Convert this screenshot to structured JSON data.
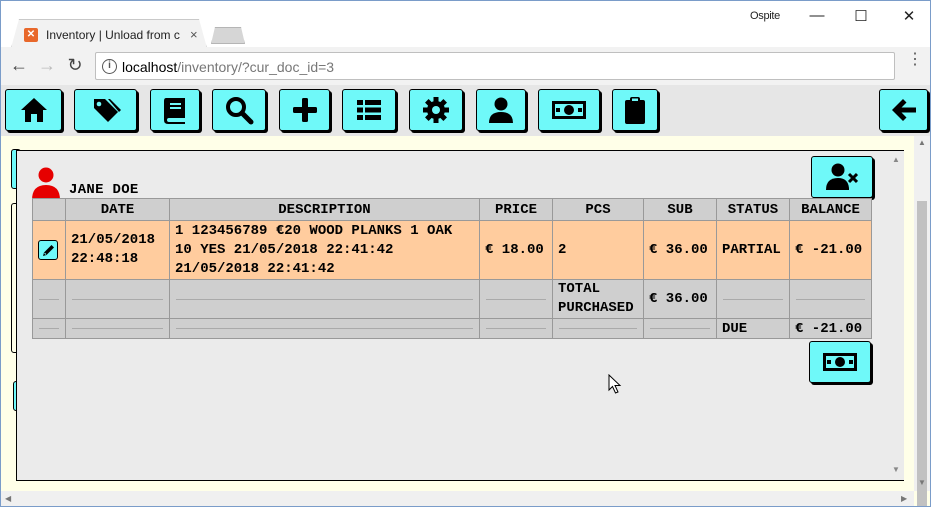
{
  "browser": {
    "tab_title": "Inventory | Unload from c",
    "profile_name": "Ospite",
    "url_host": "localhost",
    "url_path": "/inventory/?cur_doc_id=3"
  },
  "toolbar_icons": [
    "home-icon",
    "tags-icon",
    "book-icon",
    "search-icon",
    "plus-icon",
    "list-icon",
    "gear-icon",
    "user-icon",
    "money-icon",
    "clipboard-icon",
    "back-arrow-icon"
  ],
  "colors": {
    "button_bg": "#6ff9f9",
    "row_highlight": "#ffcc9e",
    "table_header": "#cfcfcf",
    "user_icon": "#e60000"
  },
  "modal": {
    "customer_name": "JANE DOE",
    "headers": {
      "date": "DATE",
      "description": "DESCRIPTION",
      "price": "PRICE",
      "pcs": "PCS",
      "sub": "SUB",
      "status": "STATUS",
      "balance": "BALANCE"
    },
    "items": [
      {
        "date_line1": "21/05/2018",
        "date_line2": "22:48:18",
        "desc_line1": "1 123456789 €20 WOOD PLANKS 1 OAK",
        "desc_line2": "10 YES 21/05/2018 22:41:42",
        "desc_line3": "21/05/2018 22:41:42",
        "price": "€ 18.00",
        "pcs": "2",
        "sub": "€ 36.00",
        "status": "PARTIAL",
        "balance": "€ -21.00"
      }
    ],
    "total_purchased_line1": "TOTAL",
    "total_purchased_line2": "PURCHASED",
    "total_purchased_value": "€ 36.00",
    "due_label": "DUE",
    "due_value": "€ -21.00"
  }
}
